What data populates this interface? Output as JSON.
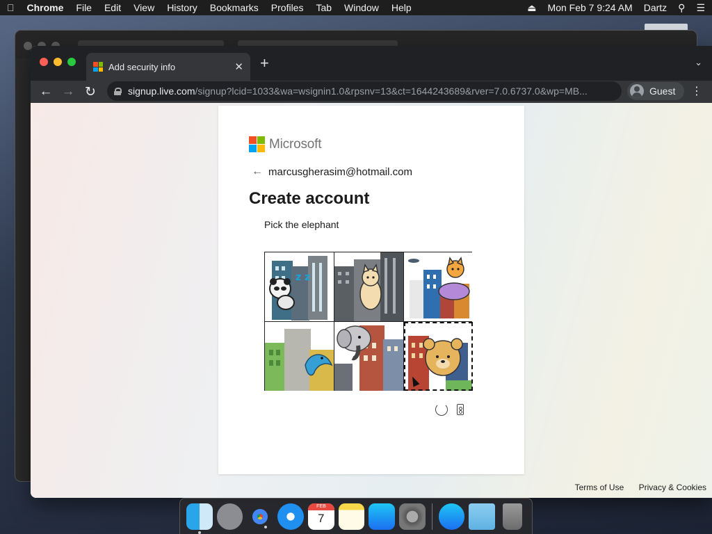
{
  "menubar": {
    "app_name": "Chrome",
    "menus": [
      "File",
      "Edit",
      "View",
      "History",
      "Bookmarks",
      "Profiles",
      "Tab",
      "Window",
      "Help"
    ],
    "datetime": "Mon Feb 7  9:24 AM",
    "user": "Dartz"
  },
  "browser": {
    "tab_title": "Add security info",
    "url_host": "signup.live.com",
    "url_path": "/signup?lcid=1033&wa=wsignin1.0&rpsnv=13&ct=1644243689&rver=7.0.6737.0&wp=MB...",
    "profile_label": "Guest"
  },
  "page": {
    "brand": "Microsoft",
    "identity_email": "marcusgherasim@hotmail.com",
    "heading": "Create account",
    "challenge_prompt": "Pick the elephant",
    "tiles": [
      {
        "animal": "panda",
        "selected": false
      },
      {
        "animal": "cat",
        "selected": false
      },
      {
        "animal": "cat-in-basket",
        "selected": false
      },
      {
        "animal": "dolphin",
        "selected": false
      },
      {
        "animal": "elephant",
        "selected": false
      },
      {
        "animal": "bear",
        "selected": true
      }
    ],
    "footer_links": [
      "Terms of Use",
      "Privacy & Cookies"
    ]
  },
  "dock": {
    "apps": [
      "finder-icon",
      "launchpad-icon",
      "chrome-icon",
      "safari-icon",
      "calendar-icon",
      "notes-icon",
      "app-store-icon",
      "system-preferences-icon",
      "app-store-downloads-icon",
      "downloads-folder-icon",
      "trash-icon"
    ],
    "calendar_month": "FEB",
    "calendar_day": "7"
  },
  "colors": {
    "ms_red": "#f25022",
    "ms_green": "#7fba00",
    "ms_blue": "#00a4ef",
    "ms_yellow": "#ffb900"
  }
}
